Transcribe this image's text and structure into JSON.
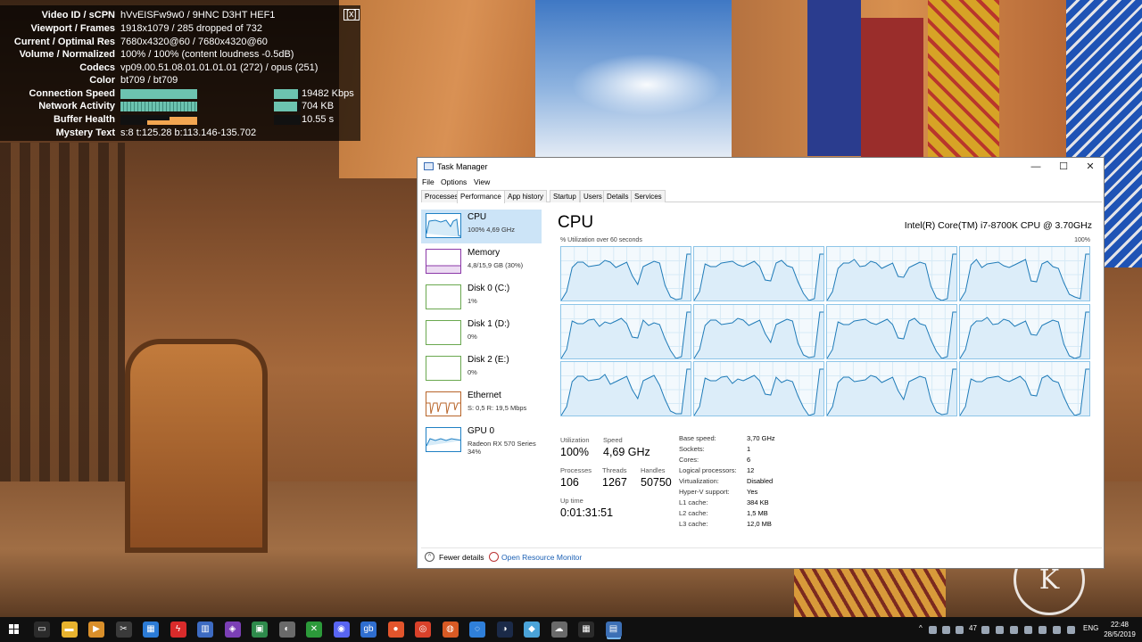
{
  "scene": {
    "watermark": "K"
  },
  "stats": {
    "close": "[x]",
    "rows": [
      {
        "label": "Video ID / sCPN",
        "value": "hVvEISFw9w0 / 9HNC D3HT HEF1"
      },
      {
        "label": "Viewport / Frames",
        "value": "1918x1079 / 285 dropped of 732"
      },
      {
        "label": "Current / Optimal Res",
        "value": "7680x4320@60 / 7680x4320@60"
      },
      {
        "label": "Volume / Normalized",
        "value": "100% / 100% (content loudness -0.5dB)"
      },
      {
        "label": "Codecs",
        "value": "vp09.00.51.08.01.01.01.01 (272) / opus (251)"
      },
      {
        "label": "Color",
        "value": "bt709 / bt709"
      },
      {
        "label": "Connection Speed",
        "value": "19482 Kbps"
      },
      {
        "label": "Network Activity",
        "value": "704 KB"
      },
      {
        "label": "Buffer Health",
        "value": "10.55 s"
      },
      {
        "label": "Mystery Text",
        "value": "s:8 t:125.28 b:113.146-135.702"
      }
    ]
  },
  "taskmanager": {
    "title": "Task Manager",
    "controls": {
      "minimize": "—",
      "maximize": "☐",
      "close": "✕"
    },
    "menu": [
      "File",
      "Options",
      "View"
    ],
    "tabs": [
      "Processes",
      "Performance",
      "App history",
      "Startup",
      "Users",
      "Details",
      "Services"
    ],
    "active_tab": "Performance",
    "sidebar": [
      {
        "name": "CPU",
        "sub": "100%  4,69 GHz",
        "sub2": "",
        "color": "#1f80c4"
      },
      {
        "name": "Memory",
        "sub": "4,8/15,9 GB (30%)",
        "sub2": "",
        "color": "#8b38a8"
      },
      {
        "name": "Disk 0 (C:)",
        "sub": "1%",
        "sub2": "",
        "color": "#6aa84f"
      },
      {
        "name": "Disk 1 (D:)",
        "sub": "0%",
        "sub2": "",
        "color": "#6aa84f"
      },
      {
        "name": "Disk 2 (E:)",
        "sub": "0%",
        "sub2": "",
        "color": "#6aa84f"
      },
      {
        "name": "Ethernet",
        "sub": "S: 0,5  R: 19,5 Mbps",
        "sub2": "",
        "color": "#b8652a"
      },
      {
        "name": "GPU 0",
        "sub": "Radeon RX 570 Series",
        "sub2": "34%",
        "color": "#1f80c4"
      }
    ],
    "cpu": {
      "title": "CPU",
      "model": "Intel(R) Core(TM) i7-8700K CPU @ 3.70GHz",
      "graph_label": "% Utilization over 60 seconds",
      "graph_max": "100%",
      "stats": {
        "utilization_label": "Utilization",
        "utilization": "100%",
        "speed_label": "Speed",
        "speed": "4,69 GHz",
        "processes_label": "Processes",
        "processes": "106",
        "threads_label": "Threads",
        "threads": "1267",
        "handles_label": "Handles",
        "handles": "50750",
        "uptime_label": "Up time",
        "uptime": "0:01:31:51"
      },
      "specs": [
        {
          "k": "Base speed:",
          "v": "3,70 GHz"
        },
        {
          "k": "Sockets:",
          "v": "1"
        },
        {
          "k": "Cores:",
          "v": "6"
        },
        {
          "k": "Logical processors:",
          "v": "12"
        },
        {
          "k": "Virtualization:",
          "v": "Disabled"
        },
        {
          "k": "Hyper-V support:",
          "v": "Yes"
        },
        {
          "k": "L1 cache:",
          "v": "384 KB"
        },
        {
          "k": "L2 cache:",
          "v": "1,5 MB"
        },
        {
          "k": "L3 cache:",
          "v": "12,0 MB"
        }
      ]
    },
    "footer": {
      "fewer_details": "Fewer details",
      "resource_monitor": "Open Resource Monitor"
    }
  },
  "taskbar": {
    "icons": [
      {
        "name": "task-view-icon",
        "color": "#2b2b2b",
        "glyph": "▭"
      },
      {
        "name": "file-explorer-icon",
        "color": "#e8b32e",
        "glyph": "▬"
      },
      {
        "name": "media-player-icon",
        "color": "#d98f2a",
        "glyph": "▶"
      },
      {
        "name": "video-editor-icon",
        "color": "#3a3a3a",
        "glyph": "✂"
      },
      {
        "name": "windows-store-icon",
        "color": "#2b7bd6",
        "glyph": "▦"
      },
      {
        "name": "adobe-app-icon",
        "color": "#d92b2b",
        "glyph": "ϟ"
      },
      {
        "name": "calculator-app-icon",
        "color": "#3d6bc2",
        "glyph": "▥"
      },
      {
        "name": "hwinfo-icon",
        "color": "#7b3fb5",
        "glyph": "◈"
      },
      {
        "name": "image-viewer-icon",
        "color": "#2e8a4b",
        "glyph": "▣"
      },
      {
        "name": "game-launcher-icon",
        "color": "#6a6a6a",
        "glyph": "◐"
      },
      {
        "name": "xbox-icon",
        "color": "#2c9a3a",
        "glyph": "✕"
      },
      {
        "name": "discord-icon",
        "color": "#5865f2",
        "glyph": "◉"
      },
      {
        "name": "gb-app-icon",
        "color": "#2f6ecf",
        "glyph": "gb"
      },
      {
        "name": "origin-icon",
        "color": "#e2552c",
        "glyph": "●"
      },
      {
        "name": "chrome-icon",
        "color": "#d9412a",
        "glyph": "◎"
      },
      {
        "name": "browser-icon",
        "color": "#d85a24",
        "glyph": "◍"
      },
      {
        "name": "uplay-icon",
        "color": "#2f7fd9",
        "glyph": "◌"
      },
      {
        "name": "steam-icon",
        "color": "#1b2a48",
        "glyph": "◑"
      },
      {
        "name": "paint-icon",
        "color": "#4aa3d8",
        "glyph": "◆"
      },
      {
        "name": "cloud-app-icon",
        "color": "#6a6a6a",
        "glyph": "☁"
      },
      {
        "name": "calculator-icon",
        "color": "#2b2b2b",
        "glyph": "▦"
      },
      {
        "name": "task-manager-taskbar-icon",
        "color": "#3c6fb5",
        "glyph": "▤"
      }
    ],
    "tray": {
      "count": "47",
      "lang": "ENG"
    },
    "clock": {
      "time": "22:48",
      "date": "28/5/2019"
    }
  }
}
